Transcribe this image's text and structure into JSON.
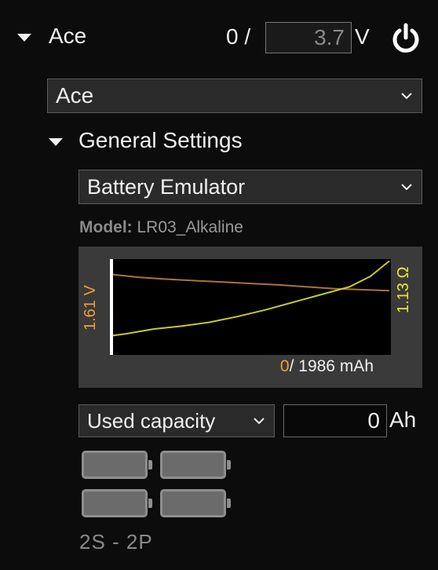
{
  "header": {
    "name": "Ace",
    "count": "0 /",
    "voltage_value": "3.7",
    "voltage_unit": "V",
    "power_icon": "power-icon"
  },
  "profile_select": {
    "value": "Ace"
  },
  "general": {
    "title": "General Settings",
    "mode_select": "Battery Emulator",
    "model_label": "Model:",
    "model_value": "LR03_Alkaline"
  },
  "chart": {
    "left_label": "1.61 V",
    "right_label": "1.13 Ω",
    "current_capacity": "0",
    "capacity_total": "/ 1986 mAh",
    "voltage_color": "#f0a030",
    "resistance_color": "#e0e030"
  },
  "chart_data": {
    "type": "line",
    "xlabel": "",
    "xlim": [
      0,
      1986
    ],
    "series": [
      {
        "x": [
          0,
          200,
          400,
          600,
          800,
          1000,
          1200,
          1400,
          1600,
          1800,
          1986
        ],
        "y": [
          0.84,
          0.81,
          0.79,
          0.775,
          0.76,
          0.745,
          0.73,
          0.71,
          0.69,
          0.68,
          0.67
        ],
        "color": "#a8743a",
        "scale": "normalized"
      },
      {
        "x": [
          0,
          100,
          300,
          500,
          700,
          900,
          1100,
          1300,
          1500,
          1700,
          1850,
          1986
        ],
        "y": [
          0.2,
          0.22,
          0.27,
          0.3,
          0.34,
          0.4,
          0.47,
          0.55,
          0.63,
          0.71,
          0.82,
          0.98
        ],
        "color": "#c8c830",
        "scale": "normalized"
      }
    ]
  },
  "capacity": {
    "mode": "Used capacity",
    "value": "0",
    "unit": "Ah"
  },
  "cells": {
    "config": "2S - 2P",
    "count": 4,
    "icon": "battery-icon"
  }
}
